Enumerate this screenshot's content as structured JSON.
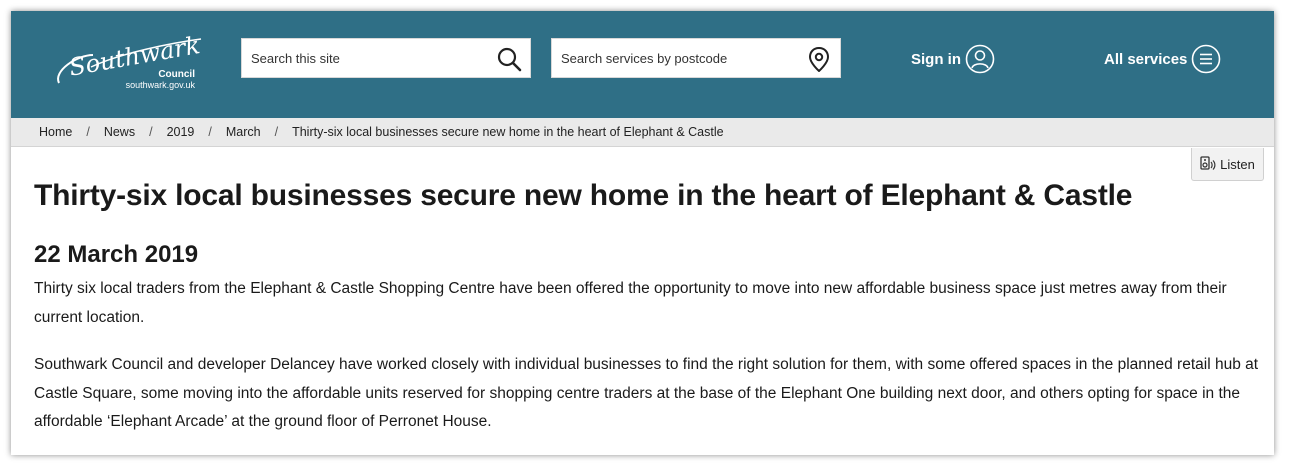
{
  "header": {
    "logo": {
      "name": "Southwark",
      "sub": "Council",
      "url": "southwark.gov.uk"
    },
    "search_site": {
      "placeholder": "Search this site",
      "icon": "search-icon"
    },
    "search_postcode": {
      "placeholder": "Search services by postcode",
      "icon": "location-pin-icon"
    },
    "sign_in": {
      "label": "Sign in",
      "icon": "user-icon"
    },
    "all_services": {
      "label": "All services",
      "icon": "menu-icon"
    },
    "colors": {
      "bar": "#2f6f86"
    }
  },
  "breadcrumb": {
    "items": [
      "Home",
      "News",
      "2019",
      "March",
      "Thirty-six local businesses secure new home in the heart of Elephant & Castle"
    ],
    "separator": "/"
  },
  "listen": {
    "label": "Listen",
    "icon": "speaker-icon"
  },
  "article": {
    "title": "Thirty-six local businesses secure new home in the heart of Elephant & Castle",
    "date": "22 March 2019",
    "paragraphs": [
      "Thirty six local traders from the Elephant & Castle Shopping Centre have been offered the opportunity to move into new affordable business space just metres away from their current location.",
      "Southwark Council and developer Delancey have worked closely with individual businesses to find the right solution for them, with some offered spaces in the planned retail hub at Castle Square, some moving into the affordable units reserved for shopping centre traders at the base of the Elephant One building next door, and others opting for space in the affordable ‘Elephant Arcade’ at the ground floor of Perronet House."
    ]
  }
}
